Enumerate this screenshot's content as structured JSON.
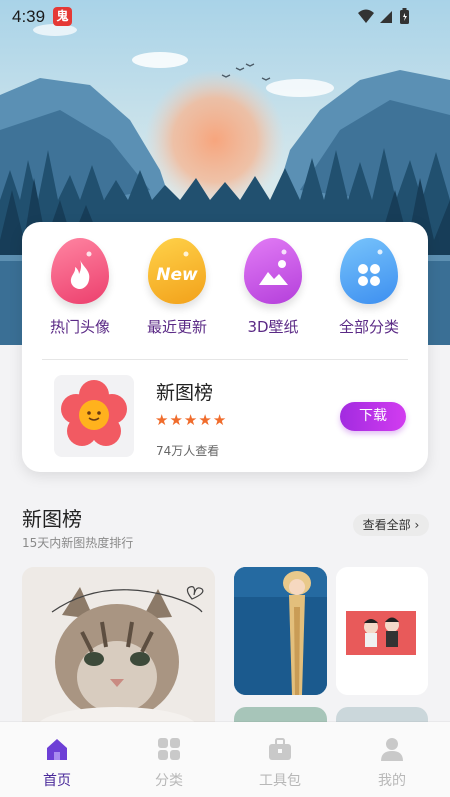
{
  "status_bar": {
    "time": "4:39",
    "app_badge": "鬼"
  },
  "categories": [
    {
      "label": "热门头像",
      "icon": "fire-icon",
      "color": "#f0577f"
    },
    {
      "label": "最近更新",
      "icon": "new-icon",
      "color": "#f7b525",
      "badge_text": "New"
    },
    {
      "label": "3D壁纸",
      "icon": "picture-icon",
      "color": "#c850e8"
    },
    {
      "label": "全部分类",
      "icon": "grid-icon",
      "color": "#4aa3f0"
    }
  ],
  "featured": {
    "title": "新图榜",
    "rating": 5,
    "views": "74万人查看",
    "download_label": "下载"
  },
  "section": {
    "title": "新图榜",
    "subtitle": "15天内新图热度排行",
    "view_all": "查看全部"
  },
  "nav": [
    {
      "label": "首页",
      "icon": "home-icon",
      "active": true
    },
    {
      "label": "分类",
      "icon": "category-grid-icon",
      "active": false
    },
    {
      "label": "工具包",
      "icon": "toolbox-icon",
      "active": false
    },
    {
      "label": "我的",
      "icon": "person-icon",
      "active": false
    }
  ]
}
